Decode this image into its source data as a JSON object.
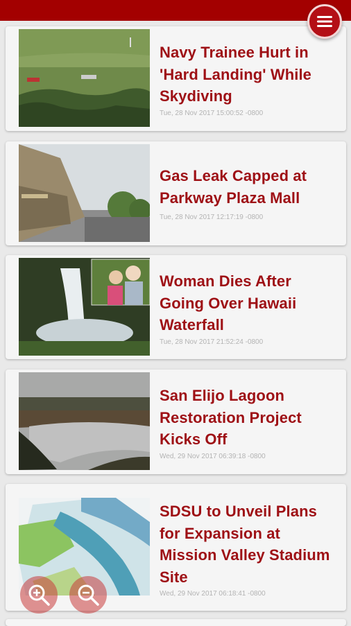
{
  "header": {
    "menu_icon": "hamburger-menu-icon",
    "bar_color": "#a30000"
  },
  "articles": [
    {
      "title": "Navy Trainee Hurt in 'Hard Landing' While Skydiving",
      "date": "Tue, 28 Nov 2017 15:00:52 -0800",
      "thumbnail": "grass field with emergency vehicles"
    },
    {
      "title": "Gas Leak Capped at Parkway Plaza Mall",
      "date": "Tue, 28 Nov 2017 12:17:19 -0800",
      "thumbnail": "mall building exterior"
    },
    {
      "title": "Woman Dies After Going Over Hawaii Waterfall",
      "date": "Tue, 28 Nov 2017 21:52:24 -0800",
      "thumbnail": "waterfall with couple inset"
    },
    {
      "title": "San Elijo Lagoon Restoration Project Kicks Off",
      "date": "Wed, 29 Nov 2017 06:39:18 -0800",
      "thumbnail": "lagoon landscape"
    },
    {
      "title": "SDSU to Unveil Plans for Expansion at Mission Valley Stadium Site",
      "date": "Wed, 29 Nov 2017 06:18:41 -0800",
      "thumbnail": "stadium site rendering"
    }
  ],
  "zoom_controls": {
    "zoom_in_icon": "zoom-in-icon",
    "zoom_out_icon": "zoom-out-icon"
  },
  "colors": {
    "title": "#9e1015",
    "date": "#b3b3b3",
    "accent": "#a30000"
  }
}
